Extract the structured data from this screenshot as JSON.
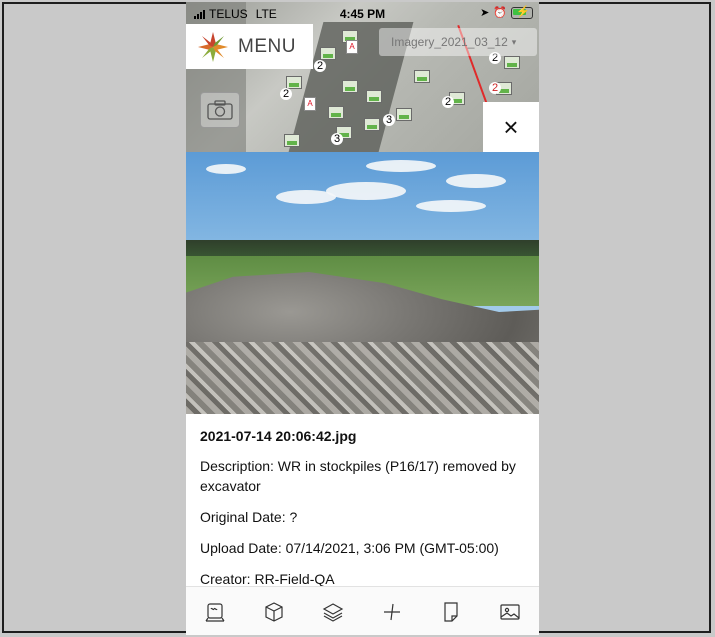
{
  "status_bar": {
    "carrier": "TELUS",
    "network": "LTE",
    "time": "4:45 PM"
  },
  "map": {
    "menu_label": "MENU",
    "imagery_layer": "Imagery_2021_03_12",
    "cluster_counts": [
      "2",
      "2",
      "3",
      "2",
      "2",
      "3",
      "2"
    ]
  },
  "close_label": "×",
  "photo": {
    "filename": "2021-07-14 20:06:42.jpg",
    "description": "Description: WR in stockpiles (P16/17) removed by excavator",
    "original_date": "Original Date: ?",
    "upload_date": "Upload Date: 07/14/2021, 3:06 PM (GMT-05:00)",
    "creator": "Creator: RR-Field-QA"
  },
  "toolbar": {
    "icons": [
      "survey-icon",
      "cube-icon",
      "layers-icon",
      "measure-icon",
      "document-icon",
      "image-icon"
    ]
  },
  "colors": {
    "background": "#c9c9c9",
    "panel": "#ffffff",
    "battery_green": "#3fc142"
  }
}
